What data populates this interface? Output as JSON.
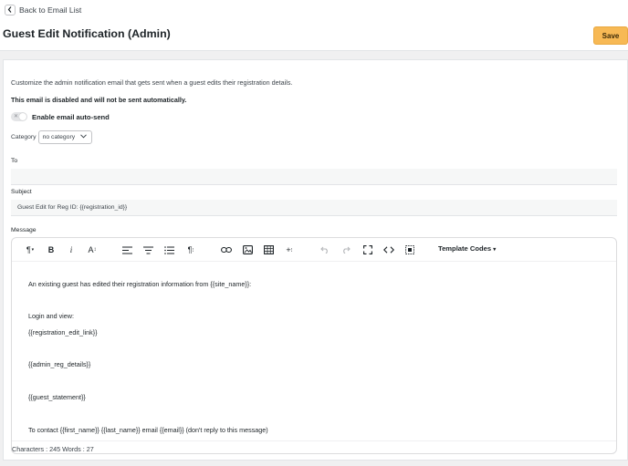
{
  "header": {
    "back_label": "Back to Email List",
    "title": "Guest Edit Notification (Admin)",
    "save_label": "Save"
  },
  "form": {
    "description": "Customize the admin notification email that gets sent when a guest edits their registration details.",
    "disabled_notice": "This email is disabled and will not be sent automatically.",
    "auto_send_label": "Enable email auto-send",
    "auto_send_enabled": false,
    "category_label": "Category",
    "category_value": "no category",
    "to_label": "To",
    "to_value": "",
    "subject_label": "Subject",
    "subject_value": "Guest Edit for Reg ID: {{registration_id}}",
    "message_label": "Message"
  },
  "editor": {
    "toolbar_icons": [
      "paragraph-format-icon",
      "bold-icon",
      "italic-icon",
      "font-size-icon",
      "align-left-icon",
      "align-center-icon",
      "list-icon",
      "paragraph-mark-icon",
      "link-icon",
      "image-icon",
      "table-icon",
      "insert-more-icon",
      "undo-icon",
      "redo-icon",
      "fullscreen-icon",
      "code-view-icon",
      "select-all-icon"
    ],
    "template_codes_label": "Template Codes",
    "lines": [
      "An existing guest has edited their registration information from {{site_name}}:",
      "Login and view:",
      "{{registration_edit_link}}",
      "{{admin_reg_details}}",
      "{{guest_statement}}",
      "To contact {{first_name}} {{last_name}} email {{email}} (don't reply to this message)"
    ],
    "status": "Characters : 245 Words : 27"
  },
  "colors": {
    "save_button": "#f7b955",
    "background": "#f0f0f1",
    "panel": "#ffffff"
  }
}
